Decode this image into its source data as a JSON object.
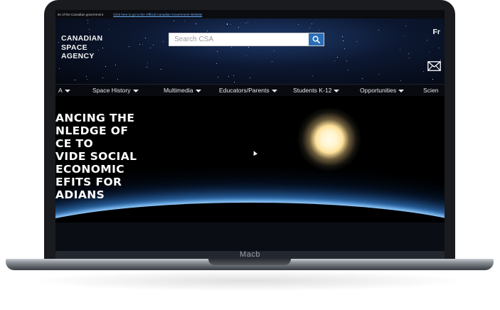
{
  "device": {
    "brand_label": "Macb"
  },
  "gov_strip": {
    "text": "ite of the Canadian government",
    "link": "Click here to go to the Official Canadian Government Website"
  },
  "header": {
    "logo_lines": [
      "CANADIAN",
      "SPACE",
      "AGENCY"
    ],
    "search_placeholder": "Search CSA",
    "language_toggle": "Fr",
    "icons": {
      "search": "search-icon",
      "mail": "mail-icon"
    }
  },
  "nav": {
    "items": [
      {
        "label": "A"
      },
      {
        "label": "Space History"
      },
      {
        "label": "Multimedia"
      },
      {
        "label": "Educators/Parents"
      },
      {
        "label": "Students K-12"
      },
      {
        "label": "Opportunities"
      },
      {
        "label": "Scien"
      }
    ]
  },
  "hero": {
    "lines": [
      "ANCING THE",
      "NLEDGE OF",
      "CE TO",
      "VIDE SOCIAL",
      "ECONOMIC",
      "EFITS FOR",
      "ADIANS"
    ]
  },
  "colors": {
    "search_button": "#2a6fb8",
    "nav_bg": "#080a10",
    "link": "#6ab0ff"
  }
}
